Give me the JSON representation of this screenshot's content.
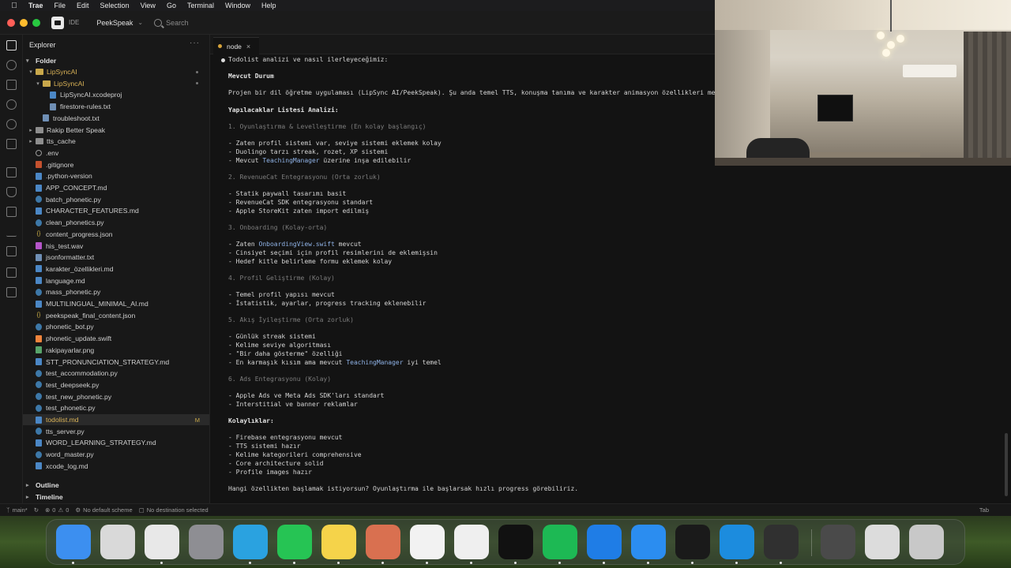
{
  "menubar": {
    "app": "Trae",
    "items": [
      "File",
      "Edit",
      "Selection",
      "View",
      "Go",
      "Terminal",
      "Window",
      "Help"
    ]
  },
  "titlebar": {
    "badge": "IDE",
    "project": "PeekSpeak",
    "search_placeholder": "Search"
  },
  "sidebar": {
    "title": "Explorer",
    "folder_label": "Folder",
    "rows": [
      {
        "label": "LipSyncAI",
        "type": "dir",
        "open": true,
        "depth": 0,
        "icon": "folder-icon",
        "accent": true
      },
      {
        "label": "LipSyncAI",
        "type": "dir",
        "open": true,
        "depth": 1,
        "icon": "folder-icon",
        "accent": true
      },
      {
        "label": "LipSyncAI.xcodeproj",
        "type": "file",
        "depth": 2,
        "icon": "xcodeproj-icon"
      },
      {
        "label": "firestore-rules.txt",
        "type": "file",
        "depth": 2,
        "icon": "txt-icon"
      },
      {
        "label": "troubleshoot.txt",
        "type": "file",
        "depth": 1,
        "icon": "txt-icon"
      },
      {
        "label": "Rakip Better Speak",
        "type": "dir",
        "open": false,
        "depth": 0,
        "icon": "folder-icon"
      },
      {
        "label": "tts_cache",
        "type": "dir",
        "open": false,
        "depth": 0,
        "icon": "folder-icon"
      },
      {
        "label": ".env",
        "type": "file",
        "depth": 0,
        "icon": "gear-icon"
      },
      {
        "label": ".gitignore",
        "type": "file",
        "depth": 0,
        "icon": "git-icon"
      },
      {
        "label": ".python-version",
        "type": "file",
        "depth": 0,
        "icon": "version-icon"
      },
      {
        "label": "APP_CONCEPT.md",
        "type": "file",
        "depth": 0,
        "icon": "markdown-icon"
      },
      {
        "label": "batch_phonetic.py",
        "type": "file",
        "depth": 0,
        "icon": "python-icon"
      },
      {
        "label": "CHARACTER_FEATURES.md",
        "type": "file",
        "depth": 0,
        "icon": "markdown-icon"
      },
      {
        "label": "clean_phonetics.py",
        "type": "file",
        "depth": 0,
        "icon": "python-icon"
      },
      {
        "label": "content_progress.json",
        "type": "file",
        "depth": 0,
        "icon": "json-icon"
      },
      {
        "label": "his_test.wav",
        "type": "file",
        "depth": 0,
        "icon": "audio-icon"
      },
      {
        "label": "jsonformatter.txt",
        "type": "file",
        "depth": 0,
        "icon": "txt-icon"
      },
      {
        "label": "karakter_özellikleri.md",
        "type": "file",
        "depth": 0,
        "icon": "markdown-icon"
      },
      {
        "label": "language.md",
        "type": "file",
        "depth": 0,
        "icon": "markdown-icon"
      },
      {
        "label": "mass_phonetic.py",
        "type": "file",
        "depth": 0,
        "icon": "python-icon"
      },
      {
        "label": "MULTILINGUAL_MINIMAL_AI.md",
        "type": "file",
        "depth": 0,
        "icon": "markdown-icon"
      },
      {
        "label": "peekspeak_final_content.json",
        "type": "file",
        "depth": 0,
        "icon": "json-icon"
      },
      {
        "label": "phonetic_bot.py",
        "type": "file",
        "depth": 0,
        "icon": "python-icon"
      },
      {
        "label": "phonetic_update.swift",
        "type": "file",
        "depth": 0,
        "icon": "swift-icon"
      },
      {
        "label": "rakipayarlar.png",
        "type": "file",
        "depth": 0,
        "icon": "image-icon"
      },
      {
        "label": "STT_PRONUNCIATION_STRATEGY.md",
        "type": "file",
        "depth": 0,
        "icon": "markdown-icon"
      },
      {
        "label": "test_accommodation.py",
        "type": "file",
        "depth": 0,
        "icon": "python-icon"
      },
      {
        "label": "test_deepseek.py",
        "type": "file",
        "depth": 0,
        "icon": "python-icon"
      },
      {
        "label": "test_new_phonetic.py",
        "type": "file",
        "depth": 0,
        "icon": "python-icon"
      },
      {
        "label": "test_phonetic.py",
        "type": "file",
        "depth": 0,
        "icon": "python-icon"
      },
      {
        "label": "todolist.md",
        "type": "file",
        "depth": 0,
        "icon": "markdown-icon",
        "selected": true,
        "status": "M",
        "accent": true
      },
      {
        "label": "tts_server.py",
        "type": "file",
        "depth": 0,
        "icon": "python-icon"
      },
      {
        "label": "WORD_LEARNING_STRATEGY.md",
        "type": "file",
        "depth": 0,
        "icon": "markdown-icon"
      },
      {
        "label": "word_master.py",
        "type": "file",
        "depth": 0,
        "icon": "python-icon"
      },
      {
        "label": "xcode_log.md",
        "type": "file",
        "depth": 0,
        "icon": "markdown-icon"
      }
    ],
    "outline_label": "Outline",
    "timeline_label": "Timeline"
  },
  "editor": {
    "tab_label": "node",
    "lines": [
      {
        "t": "Todolist analizi ve nasıl ilerleyeceğimiz:",
        "bullet": true
      },
      {
        "t": "Mevcut Durum",
        "s": "b"
      },
      {
        "t": "Projen bir dil öğretme uygulaması (LipSync AI/PeekSpeak). Şu anda temel TTS, konuşma tanıma ve karakter animasyon özellikleri mevcut"
      },
      {
        "t": "Yapılacaklar Listesi Analizi:",
        "s": "b"
      },
      {
        "t": "1. Oyunlaştırma & Levelleştirme (En kolay başlangıç)",
        "s": "d"
      },
      {
        "t": "- Zaten profil sistemi var, seviye sistemi eklemek kolay"
      },
      {
        "t": "- Duolingo tarzı streak, rozet, XP sistemi"
      },
      {
        "t": "- Mevcut ",
        "h": "TeachingManager",
        "r": " üzerine inşa edilebilir"
      },
      {
        "t": "2. RevenueCat Entegrasyonu (Orta zorluk)",
        "s": "d"
      },
      {
        "t": "- Statik paywall tasarımı basit"
      },
      {
        "t": "- RevenueCat SDK entegrasyonu standart"
      },
      {
        "t": "- Apple StoreKit zaten import edilmiş"
      },
      {
        "t": "3. Onboarding (Kolay-orta)",
        "s": "d"
      },
      {
        "t": "- Zaten ",
        "h": "OnboardingView.swift",
        "r": " mevcut"
      },
      {
        "t": "- Cinsiyet seçimi için profil resimlerini de eklemişsin"
      },
      {
        "t": "- Hedef kitle belirleme formu eklemek kolay"
      },
      {
        "t": "4. Profil Geliştirme (Kolay)",
        "s": "d"
      },
      {
        "t": "- Temel profil yapısı mevcut"
      },
      {
        "t": "- İstatistik, ayarlar, progress tracking eklenebilir"
      },
      {
        "t": "5. Akış İyileştirme (Orta zorluk)",
        "s": "d"
      },
      {
        "t": "- Günlük streak sistemi"
      },
      {
        "t": "- Kelime seviye algoritması"
      },
      {
        "t": "- \"Bir daha gösterme\" özelliği"
      },
      {
        "t": "- En karmaşık kısım ama mevcut ",
        "h": "TeachingManager",
        "r": " iyi temel"
      },
      {
        "t": "6. Ads Entegrasyonu (Kolay)",
        "s": "d"
      },
      {
        "t": "- Apple Ads ve Meta Ads SDK'ları standart"
      },
      {
        "t": "- Interstitial ve banner reklamlar"
      },
      {
        "t": "Kolaylıklar:",
        "s": "b"
      },
      {
        "t": "- Firebase entegrasyonu mevcut"
      },
      {
        "t": "- TTS sistemi hazır"
      },
      {
        "t": "- Kelime kategorileri comprehensive"
      },
      {
        "t": "- Core architecture solid"
      },
      {
        "t": "- Profile images hazır"
      },
      {
        "t": "Hangi özellikten başlamak istiyorsun? Oyunlaştırma ile başlarsak hızlı progress görebiliriz."
      }
    ]
  },
  "statusbar": {
    "branch": "main*",
    "errors": "0",
    "warnings": "0",
    "scheme": "No default scheme",
    "destination": "No destination selected",
    "tab_size": "Tab"
  },
  "dock": {
    "apps": [
      {
        "name": "finder-icon",
        "color": "#3c8ff0"
      },
      {
        "name": "launchpad-icon",
        "color": "#d9d9d9"
      },
      {
        "name": "chrome-icon",
        "color": "#e8e8e8"
      },
      {
        "name": "system-settings-icon",
        "color": "#8e8e93"
      },
      {
        "name": "telegram-icon",
        "color": "#2aa2e0"
      },
      {
        "name": "whatsapp-icon",
        "color": "#26c454"
      },
      {
        "name": "notes-icon",
        "color": "#f5d34a"
      },
      {
        "name": "claude-icon",
        "color": "#d97050"
      },
      {
        "name": "chatgpt-icon",
        "color": "#f2f2f2"
      },
      {
        "name": "textedit-icon",
        "color": "#efefef"
      },
      {
        "name": "terminal-icon",
        "color": "#111111"
      },
      {
        "name": "spotify-icon",
        "color": "#1db954"
      },
      {
        "name": "xcode-icon",
        "color": "#1f7de6"
      },
      {
        "name": "instruments-icon",
        "color": "#2b8df0"
      },
      {
        "name": "trae-icon",
        "color": "#1a1a1a"
      },
      {
        "name": "vscode-icon",
        "color": "#1c8cde"
      },
      {
        "name": "obs-icon",
        "color": "#303030"
      },
      {
        "name": "screenshot-preview-icon",
        "color": "#4a4a4a"
      },
      {
        "name": "downloads-stack-icon",
        "color": "#dcdcdc"
      },
      {
        "name": "trash-icon",
        "color": "#c8c8c8"
      }
    ]
  }
}
